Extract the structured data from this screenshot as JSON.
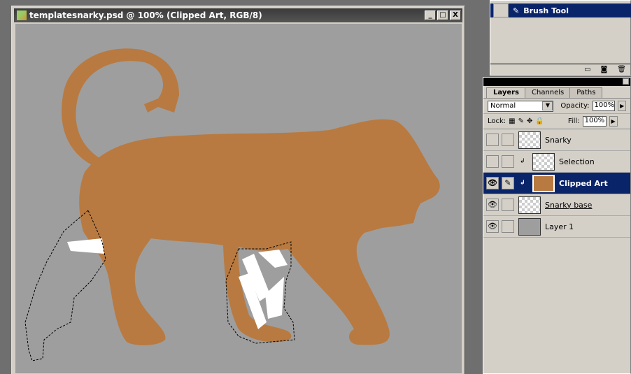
{
  "document": {
    "title": "templatesnarky.psd @ 100% (Clipped Art, RGB/8)",
    "buttons": {
      "minimize": "_",
      "maximize": "□",
      "close": "X"
    }
  },
  "history": {
    "active_item": "Brush Tool"
  },
  "layers_panel": {
    "tabs": [
      "Layers",
      "Channels",
      "Paths"
    ],
    "blend_mode": "Normal",
    "opacity_label": "Opacity:",
    "opacity": "100%",
    "lock_label": "Lock:",
    "fill_label": "Fill:",
    "fill": "100%",
    "layers": [
      {
        "name": "Snarky",
        "visible": false
      },
      {
        "name": "Selection",
        "visible": false,
        "clipped": true
      },
      {
        "name": "Clipped Art",
        "visible": true,
        "clipped": true,
        "active": true
      },
      {
        "name": "Snarky base",
        "visible": true
      },
      {
        "name": "Layer 1",
        "visible": true
      }
    ]
  },
  "colors": {
    "art": "#b87a40",
    "canvas": "#9e9e9e",
    "highlight": "#0a246a"
  }
}
